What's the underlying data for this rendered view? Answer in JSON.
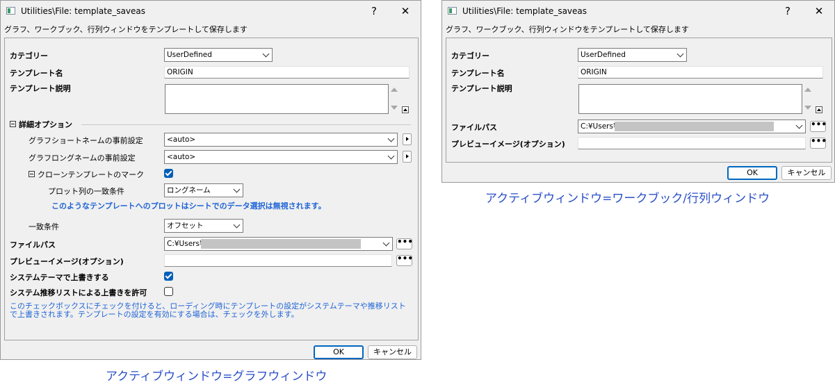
{
  "dialog": {
    "title": "Utilities\\File: template_saveas",
    "help_label": "?",
    "close_label": "✕",
    "subtitle": "グラフ、ワークブック、行列ウィンドウをテンプレートして保存します"
  },
  "fields": {
    "category_label": "カテゴリー",
    "category_value": "UserDefined",
    "template_name_label": "テンプレート名",
    "template_name_value": "ORIGIN",
    "template_desc_label": "テンプレート説明",
    "advanced_label": "詳細オプション",
    "short_name_label": "グラフショートネームの事前設定",
    "short_name_value": "<auto>",
    "long_name_label": "グラフロングネームの事前設定",
    "long_name_value": "<auto>",
    "clone_mark_label": "クローンテンプレートのマーク",
    "clone_mark_checked": true,
    "plot_match_label": "プロット列の一致条件",
    "plot_match_value": "ロングネーム",
    "clone_note": "このようなテンプレートへのプロットはシートでのデータ選択は無視されます。",
    "match_label": "一致条件",
    "match_value": "オフセット",
    "file_path_label": "ファイルパス",
    "file_path_value": "C:¥Users¥",
    "preview_label": "プレビューイメージ(オプション)",
    "preview_value": "",
    "override_theme_label": "システムテーマで上書きする",
    "override_theme_checked": true,
    "allow_recommend_label": "システム推移リストによる上書きを許可",
    "allow_recommend_checked": false,
    "help_note": "このチェックボックスにチェックを付けると、ローディング時にテンプレートの設定がシステムテーマや推移リストで上書きされます。テンプレートの設定を有効にする場合は、チェックを外します。"
  },
  "buttons": {
    "ok": "OK",
    "cancel": "キャンセル",
    "browse": "•••"
  },
  "captions": {
    "graph": "アクティブウィンドウ=グラフウィンドウ",
    "workbook": "アクティブウィンドウ=ワークブック/行列ウィンドウ"
  },
  "colors": {
    "accent": "#005fb8",
    "note": "#1e63d6",
    "caption": "#2a4fc7"
  }
}
